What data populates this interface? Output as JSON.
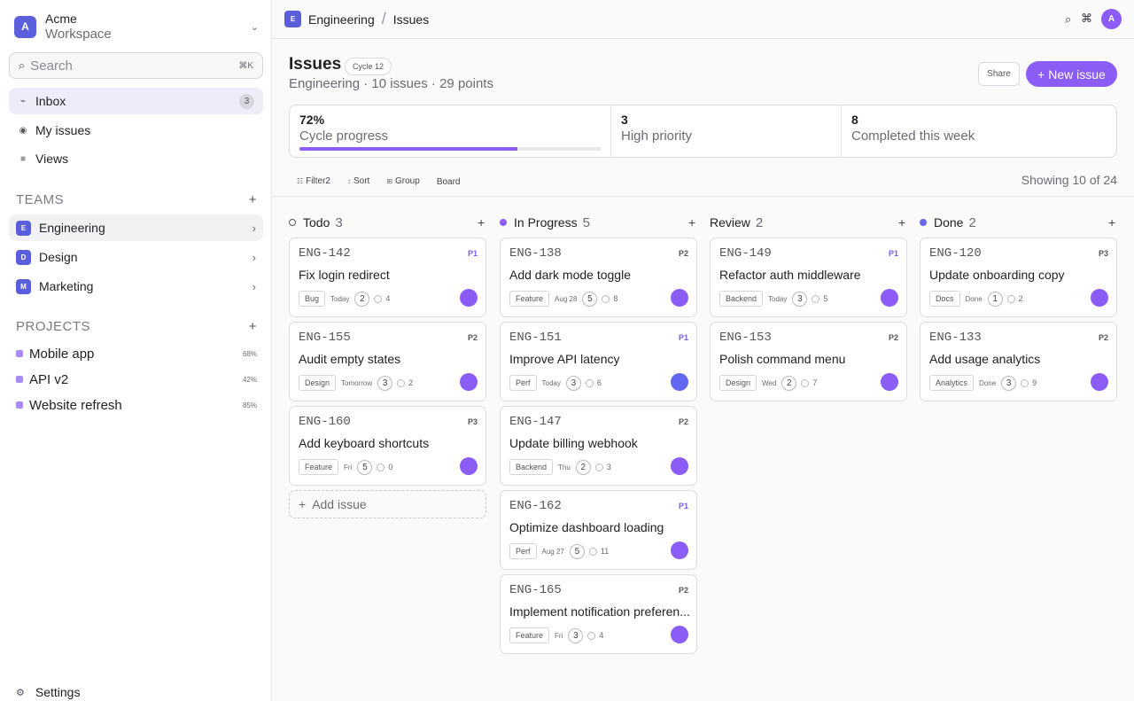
{
  "workspace": {
    "avatar": "A",
    "name_line1": "Acme",
    "name_line2": "Workspace"
  },
  "search": {
    "placeholder": "Search",
    "shortcut": "⌘K"
  },
  "nav": [
    {
      "label": "Inbox",
      "badge": "3",
      "icon": "inbox-icon"
    },
    {
      "label": "My issues",
      "icon": "target-icon"
    },
    {
      "label": "Views",
      "icon": "views-icon"
    }
  ],
  "teams": {
    "heading": "TEAMS",
    "items": [
      {
        "initial": "E",
        "label": "Engineering"
      },
      {
        "initial": "D",
        "label": "Design"
      },
      {
        "initial": "M",
        "label": "Marketing"
      }
    ]
  },
  "projects": {
    "heading": "PROJECTS",
    "items": [
      {
        "label": "Mobile app",
        "progress": "68%"
      },
      {
        "label": "API v2",
        "progress": "42%"
      },
      {
        "label": "Website refresh",
        "progress": "85%"
      }
    ]
  },
  "settings_label": "Settings",
  "breadcrumb": {
    "team_initial": "E",
    "team": "Engineering",
    "page": "Issues"
  },
  "user_avatar": "A",
  "header": {
    "title": "Issues",
    "cycle": "Cycle 12",
    "subtitle": "Engineering · 10 issues · 29 points",
    "share_label": "Share",
    "new_label": "+ New issue"
  },
  "stats": {
    "progress_value": "72%",
    "progress_label": "Cycle progress",
    "progress_fraction": 0.72,
    "high_value": "3",
    "high_label": "High priority",
    "done_value": "8",
    "done_label": "Completed this week"
  },
  "toolbar": {
    "filter": "Filter",
    "filter_count": "2",
    "sort": "Sort",
    "group": "Group",
    "board": "Board",
    "showing": "Showing 10 of 24"
  },
  "columns": [
    {
      "name": "Todo",
      "count": "3",
      "cards": [
        {
          "id": "ENG-142",
          "priority": "P1",
          "title": "Fix login redirect",
          "tag": "Bug",
          "due": "Today",
          "estimate": "2",
          "comments": "4"
        },
        {
          "id": "ENG-155",
          "priority": "P2",
          "title": "Audit empty states",
          "tag": "Design",
          "due": "Tomorrow",
          "estimate": "3",
          "comments": "2"
        },
        {
          "id": "ENG-160",
          "priority": "P3",
          "title": "Add keyboard shortcuts",
          "tag": "Feature",
          "due": "Fri",
          "estimate": "5",
          "comments": "0"
        }
      ]
    },
    {
      "name": "In Progress",
      "count": "5",
      "cards": [
        {
          "id": "ENG-138",
          "priority": "P2",
          "title": "Add dark mode toggle",
          "tag": "Feature",
          "due": "Aug 28",
          "estimate": "5",
          "comments": "8"
        },
        {
          "id": "ENG-151",
          "priority": "P1",
          "title": "Improve API latency",
          "tag": "Perf",
          "due": "Today",
          "estimate": "3",
          "comments": "6"
        },
        {
          "id": "ENG-147",
          "priority": "P2",
          "title": "Update billing webhook",
          "tag": "Backend",
          "due": "Thu",
          "estimate": "2",
          "comments": "3"
        },
        {
          "id": "ENG-162",
          "priority": "P1",
          "title": "Optimize dashboard loading",
          "tag": "Perf",
          "due": "Aug 27",
          "estimate": "5",
          "comments": "11"
        },
        {
          "id": "ENG-165",
          "priority": "P2",
          "title": "Implement notification preferen...",
          "tag": "Feature",
          "due": "Fri",
          "estimate": "3",
          "comments": "4"
        }
      ]
    },
    {
      "name": "Review",
      "count": "2",
      "cards": [
        {
          "id": "ENG-149",
          "priority": "P1",
          "title": "Refactor auth middleware",
          "tag": "Backend",
          "due": "Today",
          "estimate": "3",
          "comments": "5"
        },
        {
          "id": "ENG-153",
          "priority": "P2",
          "title": "Polish command menu",
          "tag": "Design",
          "due": "Wed",
          "estimate": "2",
          "comments": "7"
        }
      ]
    },
    {
      "name": "Done",
      "count": "2",
      "cards": [
        {
          "id": "ENG-120",
          "priority": "P3",
          "title": "Update onboarding copy",
          "tag": "Docs",
          "due": "Done",
          "estimate": "1",
          "comments": "2"
        },
        {
          "id": "ENG-133",
          "priority": "P2",
          "title": "Add usage analytics",
          "tag": "Analytics",
          "due": "Done",
          "estimate": "3",
          "comments": "9"
        }
      ]
    }
  ],
  "add_issue_label": "Add issue",
  "colors": {
    "accent": "#8b5cf6",
    "team": "#5b5fdc",
    "in_progress_dot": "#8b5cf6",
    "done_dot": "#6366f1"
  }
}
